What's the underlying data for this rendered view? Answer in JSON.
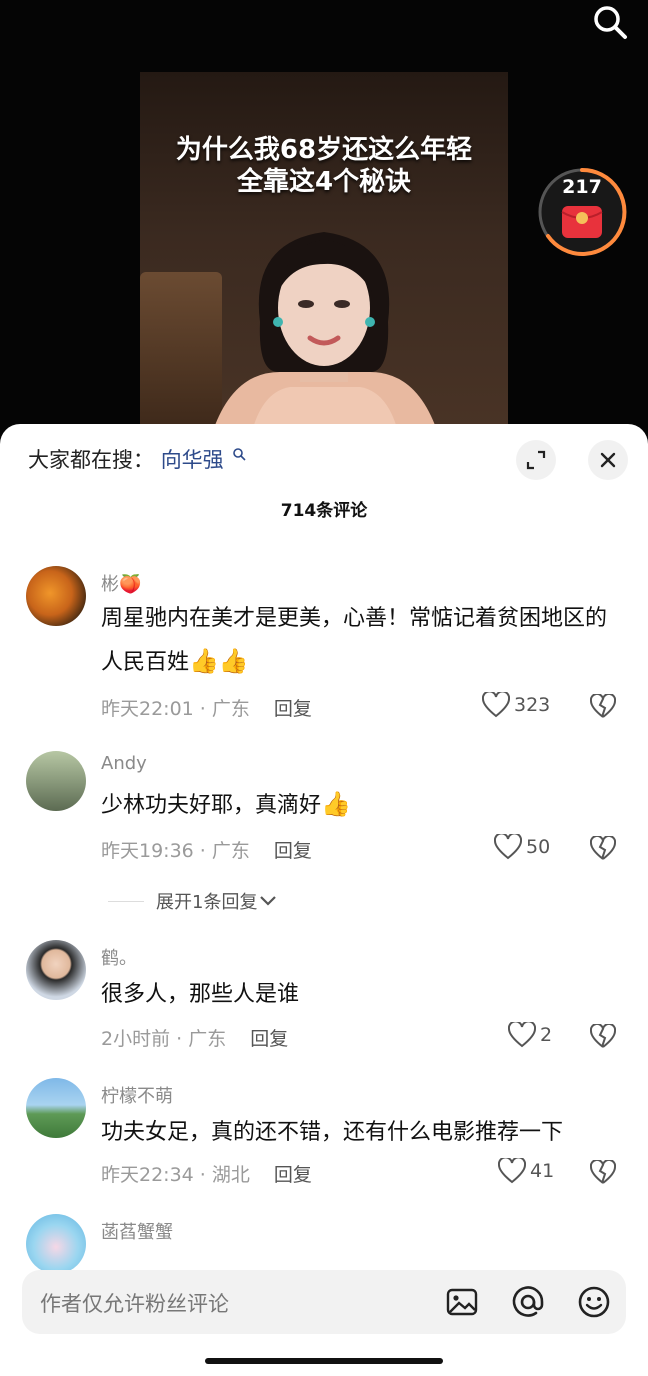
{
  "video": {
    "caption_line1": "为什么我68岁还这么年轻",
    "caption_line2": "全靠这4个秘诀",
    "red_packet_count": "217"
  },
  "sheet": {
    "trending_label": "大家都在搜：",
    "trending_keyword": "向华强",
    "comment_count": "714条评论"
  },
  "comments": [
    {
      "name": "彬🍑",
      "text": "周星驰内在美才是更美，心善！常惦记着贫困地区的人民百姓",
      "emoji": "👍👍",
      "time": "昨天22:01",
      "location": "广东",
      "reply": "回复",
      "likes": "323"
    },
    {
      "name": "Andy",
      "text": "少林功夫好耶，真滴好",
      "emoji": "👍",
      "time": "昨天19:36",
      "location": "广东",
      "reply": "回复",
      "likes": "50",
      "expand": "展开1条回复"
    },
    {
      "name": "鹤。",
      "text": "很多人，那些人是谁",
      "time": "2小时前",
      "location": "广东",
      "reply": "回复",
      "likes": "2"
    },
    {
      "name": "柠檬不萌",
      "text": "功夫女足，真的还不错，还有什么电影推荐一下",
      "time": "昨天22:34",
      "location": "湖北",
      "reply": "回复",
      "likes": "41"
    },
    {
      "name": "菡萏蟹蟹"
    }
  ],
  "input": {
    "placeholder": "作者仅允许粉丝评论"
  },
  "colors": {
    "keyword": "#2d4a8a",
    "red_packet": "#e8323c"
  },
  "icons": [
    "search-icon",
    "expand-icon",
    "close-icon",
    "heart-icon",
    "broken-heart-icon",
    "image-icon",
    "at-icon",
    "emoji-icon"
  ]
}
